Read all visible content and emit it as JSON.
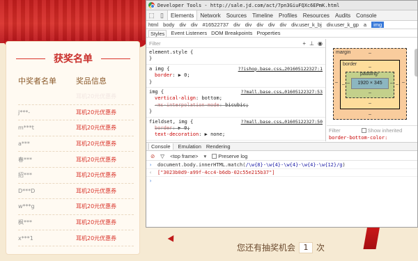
{
  "page": {
    "winners_title": "获奖名单",
    "col_winner": "中奖者名单",
    "col_prize": "奖品信息",
    "winners": [
      {
        "name": "",
        "prize": "耳机20元优惠券",
        "faint": true
      },
      {
        "name": "j***-",
        "prize": "耳机20元优惠券",
        "faint": false
      },
      {
        "name": "m***t",
        "prize": "耳机20元优惠券",
        "faint": false
      },
      {
        "name": "a***",
        "prize": "耳机20元优惠券",
        "faint": false
      },
      {
        "name": "春***",
        "prize": "耳机20元优惠券",
        "faint": false
      },
      {
        "name": "招***",
        "prize": "耳机20元优惠券",
        "faint": false
      },
      {
        "name": "D***D",
        "prize": "耳机20元优惠券",
        "faint": false
      },
      {
        "name": "w***g",
        "prize": "耳机20元优惠券",
        "faint": false
      },
      {
        "name": "枫***",
        "prize": "耳机20元优惠券",
        "faint": false
      },
      {
        "name": "x***1",
        "prize": "耳机20元优惠券",
        "faint": false
      }
    ],
    "chance_prefix": "您还有抽奖机会",
    "chance_count": "1",
    "chance_suffix": "次"
  },
  "devtools": {
    "window_title": "Developer Tools - http://sale.jd.com/act/7pn3GiuFQXc6EPmK.html",
    "tabs": [
      "Elements",
      "Network",
      "Sources",
      "Timeline",
      "Profiles",
      "Resources",
      "Audits",
      "Console"
    ],
    "active_tab": "Elements",
    "breadcrumbs": [
      "html",
      "body",
      "div",
      "div",
      "#16522737",
      "div",
      "div",
      "div",
      "div",
      "div",
      "div.user_k_bj",
      "div.user_k_gp",
      "a",
      "img"
    ],
    "selected_crumb": "img",
    "subtabs": [
      "Styles",
      "Event Listeners",
      "DOM Breakpoints",
      "Properties"
    ],
    "filter_placeholder": "Filter",
    "filter_icons": [
      "+",
      "⊥",
      "◉"
    ],
    "rules": [
      {
        "selector": "element.style {",
        "source": "",
        "props": [],
        "close": "}"
      },
      {
        "selector": "a img {",
        "source": "??ishop.base.css…201605122327:1",
        "props": [
          {
            "name": "border",
            "value": "▶ 0;",
            "strike": false
          }
        ],
        "close": "}"
      },
      {
        "selector": "img {",
        "source": "??mall.base.css…01605122327:53",
        "props": [
          {
            "name": "vertical-align",
            "value": "bottom;",
            "strike": false
          },
          {
            "name": "-ms-interpolation-mode",
            "value": "bicubic;",
            "strike": true
          }
        ],
        "close": "}"
      },
      {
        "selector": "fieldset, img {",
        "source": "??mall.base.css…01605122327:50",
        "props": [
          {
            "name": "border",
            "value": "▶ 0;",
            "strike": true
          },
          {
            "name": "text-decoration",
            "value": "▶ none;",
            "strike": false
          }
        ],
        "close": ""
      }
    ],
    "metrics": {
      "margin_label": "margin",
      "border_label": "border",
      "padding_label": "padding-",
      "content": "1920 × 345",
      "dash": "–"
    },
    "metrics_filter": "Filter",
    "show_inherited": "Show inherited",
    "cut_property": "border-bottom-color:",
    "drawer_tabs": [
      "Console",
      "Emulation",
      "Rendering"
    ],
    "active_drawer_tab": "Console",
    "frame_select": "<top frame>",
    "preserve_log": "Preserve log",
    "console_input_prefix": "document.body.innerHTML.match(",
    "console_regex": "/\\w{8}-\\w{4}-\\w{4}-\\w{4}-\\w{12}/g",
    "console_input_suffix": ")",
    "console_output": "[\"3023b0d9-a99f-4cc4-b6db-02c55e215b37\"]",
    "icons": {
      "no-entry": "⊘",
      "funnel": "▽",
      "mobile": "▯",
      "inspect": "⬚",
      "gear": "⚙",
      "dock": "▭",
      "close": "✕"
    }
  }
}
